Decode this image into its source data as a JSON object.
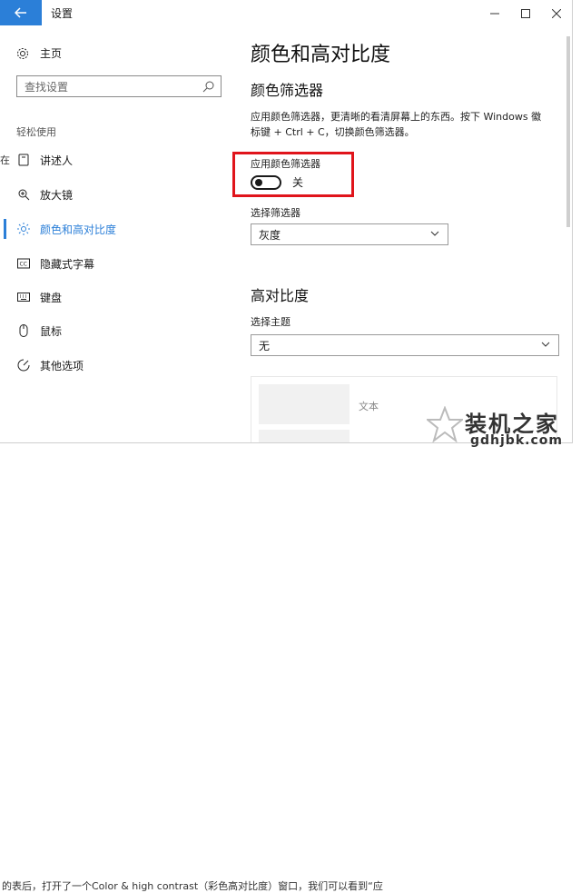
{
  "window": {
    "title": "设置",
    "controls": {
      "minimize": "minimize-icon",
      "maximize": "maximize-icon",
      "close": "close-icon"
    }
  },
  "sidebar": {
    "home_label": "主页",
    "search_placeholder": "查找设置",
    "section_label": "轻松使用",
    "items": [
      {
        "label": "讲述人",
        "icon": "narrator-icon"
      },
      {
        "label": "放大镜",
        "icon": "magnifier-icon"
      },
      {
        "label": "颜色和高对比度",
        "icon": "brightness-icon",
        "selected": true
      },
      {
        "label": "隐藏式字幕",
        "icon": "closed-captions-icon"
      },
      {
        "label": "键盘",
        "icon": "keyboard-icon"
      },
      {
        "label": "鼠标",
        "icon": "mouse-icon"
      },
      {
        "label": "其他选项",
        "icon": "other-options-icon"
      }
    ]
  },
  "main": {
    "title": "颜色和高对比度",
    "color_filter": {
      "heading": "颜色筛选器",
      "description": "应用颜色筛选器，更清晰的看清屏幕上的东西。按下 Windows 徽标键 + Ctrl + C，切换颜色筛选器。",
      "toggle_label": "应用颜色筛选器",
      "toggle_state": "关",
      "toggle_on": false,
      "select_label": "选择筛选器",
      "select_value": "灰度"
    },
    "high_contrast": {
      "heading": "高对比度",
      "select_label": "选择主题",
      "select_value": "无",
      "preview_text": "文本"
    }
  },
  "page_background": {
    "side_char": "在",
    "caption": "的表后，打开了一个Color & high contrast（彩色高对比度）窗口，我们可以看到“应"
  },
  "watermark": {
    "title": "装机之家",
    "url": "gdhjbk.com"
  },
  "colors": {
    "accent": "#2b7fd8",
    "highlight_box": "#e0141b"
  }
}
